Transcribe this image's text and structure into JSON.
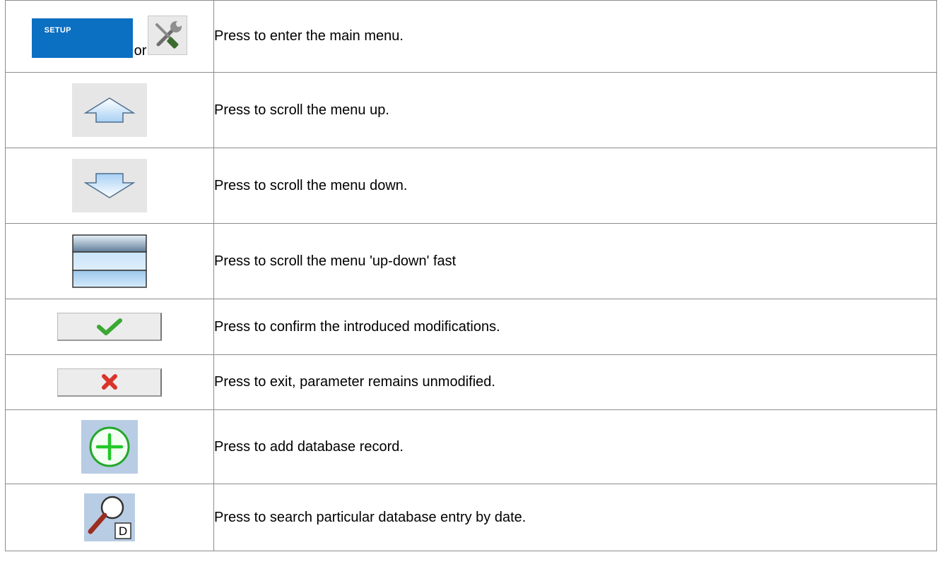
{
  "rows": [
    {
      "icon": "setup-button",
      "icon_label": "SETUP",
      "or_text": "or",
      "alt_icon": "wrench-screwdriver-icon",
      "description": "Press to enter the main menu."
    },
    {
      "icon": "arrow-up-icon",
      "description": "Press to scroll the menu up."
    },
    {
      "icon": "arrow-down-icon",
      "description": "Press to scroll the menu down."
    },
    {
      "icon": "fast-scroll-bar-icon",
      "description": "Press to scroll the menu 'up-down' fast"
    },
    {
      "icon": "green-checkmark-icon",
      "description": "Press to confirm the introduced modifications."
    },
    {
      "icon": "red-x-icon",
      "description": "Press to exit, parameter remains unmodified."
    },
    {
      "icon": "add-circle-icon",
      "description": "Press to add database record."
    },
    {
      "icon": "magnifier-date-icon",
      "icon_label": "D",
      "description": "Press to search particular database entry by date."
    }
  ],
  "colors": {
    "setup_blue": "#0b6fc2",
    "check_green": "#3aa832",
    "x_red": "#d9332b",
    "plus_green": "#22c82a",
    "icon_bg_blue": "#b8cde4"
  }
}
